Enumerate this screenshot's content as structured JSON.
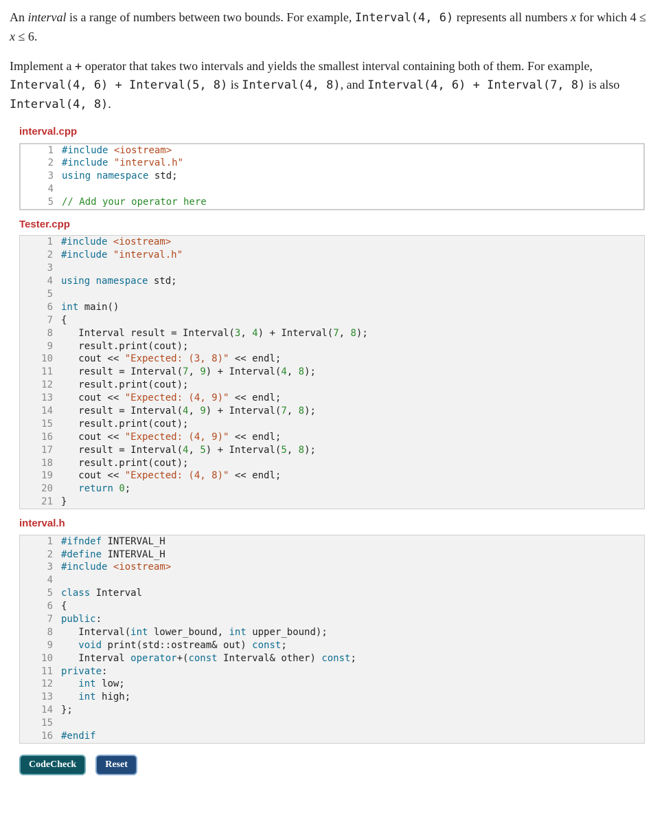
{
  "prose": {
    "p1_a": "An ",
    "p1_interval": "interval",
    "p1_b": " is a range of numbers between two bounds. For example, ",
    "p1_code1": "Interval(4, 6)",
    "p1_c": " represents all numbers ",
    "p1_x1": "x",
    "p1_d": " for which 4 ≤ ",
    "p1_x2": "x",
    "p1_e": " ≤ 6.",
    "p2_a": "Implement a ",
    "p2_plus": "+",
    "p2_b": " operator that takes two intervals and yields the smallest interval containing both of them. For example, ",
    "p2_code1": "Interval(4, 6) + Interval(5, 8)",
    "p2_c": " is ",
    "p2_code2": "Interval(4, 8)",
    "p2_d": ", and ",
    "p2_code3": "Interval(4, 6) + Interval(7, 8)",
    "p2_e": " is also ",
    "p2_code4": "Interval(4, 8)",
    "p2_f": "."
  },
  "files": {
    "f1_name": "interval.cpp",
    "f2_name": "Tester.cpp",
    "f3_name": "interval.h"
  },
  "buttons": {
    "codecheck": "CodeCheck",
    "reset": "Reset"
  },
  "code": {
    "interval_cpp": [
      {
        "n": "1",
        "h": "<span class='pp'>#include</span> <span class='ppinc'>&lt;iostream&gt;</span>"
      },
      {
        "n": "2",
        "h": "<span class='pp'>#include</span> <span class='ppinc'>\"interval.h\"</span>"
      },
      {
        "n": "3",
        "h": "<span class='kw'>using</span> <span class='kw'>namespace</span> std;"
      },
      {
        "n": "4",
        "h": ""
      },
      {
        "n": "5",
        "h": "<span class='cmt'>// Add your operator here</span>"
      }
    ],
    "tester_cpp": [
      {
        "n": "1",
        "h": "<span class='pp'>#include</span> <span class='ppinc'>&lt;iostream&gt;</span>"
      },
      {
        "n": "2",
        "h": "<span class='pp'>#include</span> <span class='ppinc'>\"interval.h\"</span>"
      },
      {
        "n": "3",
        "h": ""
      },
      {
        "n": "4",
        "h": "<span class='kw'>using</span> <span class='kw'>namespace</span> std;"
      },
      {
        "n": "5",
        "h": ""
      },
      {
        "n": "6",
        "h": "<span class='kw'>int</span> main()"
      },
      {
        "n": "7",
        "h": "{"
      },
      {
        "n": "8",
        "h": "   Interval result = Interval(<span class='lit'>3</span>, <span class='lit'>4</span>) + Interval(<span class='lit'>7</span>, <span class='lit'>8</span>);"
      },
      {
        "n": "9",
        "h": "   result.print(cout);"
      },
      {
        "n": "10",
        "h": "   cout &lt;&lt; <span class='str'>\"Expected: (3, 8)\"</span> &lt;&lt; endl;"
      },
      {
        "n": "11",
        "h": "   result = Interval(<span class='lit'>7</span>, <span class='lit'>9</span>) + Interval(<span class='lit'>4</span>, <span class='lit'>8</span>);"
      },
      {
        "n": "12",
        "h": "   result.print(cout);"
      },
      {
        "n": "13",
        "h": "   cout &lt;&lt; <span class='str'>\"Expected: (4, 9)\"</span> &lt;&lt; endl;"
      },
      {
        "n": "14",
        "h": "   result = Interval(<span class='lit'>4</span>, <span class='lit'>9</span>) + Interval(<span class='lit'>7</span>, <span class='lit'>8</span>);"
      },
      {
        "n": "15",
        "h": "   result.print(cout);"
      },
      {
        "n": "16",
        "h": "   cout &lt;&lt; <span class='str'>\"Expected: (4, 9)\"</span> &lt;&lt; endl;"
      },
      {
        "n": "17",
        "h": "   result = Interval(<span class='lit'>4</span>, <span class='lit'>5</span>) + Interval(<span class='lit'>5</span>, <span class='lit'>8</span>);"
      },
      {
        "n": "18",
        "h": "   result.print(cout);"
      },
      {
        "n": "19",
        "h": "   cout &lt;&lt; <span class='str'>\"Expected: (4, 8)\"</span> &lt;&lt; endl;"
      },
      {
        "n": "20",
        "h": "   <span class='kw'>return</span> <span class='lit'>0</span>;"
      },
      {
        "n": "21",
        "h": "}"
      }
    ],
    "interval_h": [
      {
        "n": "1",
        "h": "<span class='pp'>#ifndef</span> INTERVAL_H"
      },
      {
        "n": "2",
        "h": "<span class='pp'>#define</span> INTERVAL_H"
      },
      {
        "n": "3",
        "h": "<span class='pp'>#include</span> <span class='ppinc'>&lt;iostream&gt;</span>"
      },
      {
        "n": "4",
        "h": ""
      },
      {
        "n": "5",
        "h": "<span class='kw'>class</span> Interval"
      },
      {
        "n": "6",
        "h": "{"
      },
      {
        "n": "7",
        "h": "<span class='kw'>public</span>:"
      },
      {
        "n": "8",
        "h": "   Interval(<span class='kw'>int</span> lower_bound, <span class='kw'>int</span> upper_bound);"
      },
      {
        "n": "9",
        "h": "   <span class='kw'>void</span> print(std::ostream&amp; out) <span class='kw'>const</span>;"
      },
      {
        "n": "10",
        "h": "   Interval <span class='kw'>operator</span>+(<span class='kw'>const</span> Interval&amp; other) <span class='kw'>const</span>;"
      },
      {
        "n": "11",
        "h": "<span class='kw'>private</span>:"
      },
      {
        "n": "12",
        "h": "   <span class='kw'>int</span> low;"
      },
      {
        "n": "13",
        "h": "   <span class='kw'>int</span> high;"
      },
      {
        "n": "14",
        "h": "};"
      },
      {
        "n": "15",
        "h": ""
      },
      {
        "n": "16",
        "h": "<span class='pp'>#endif</span>"
      }
    ]
  }
}
